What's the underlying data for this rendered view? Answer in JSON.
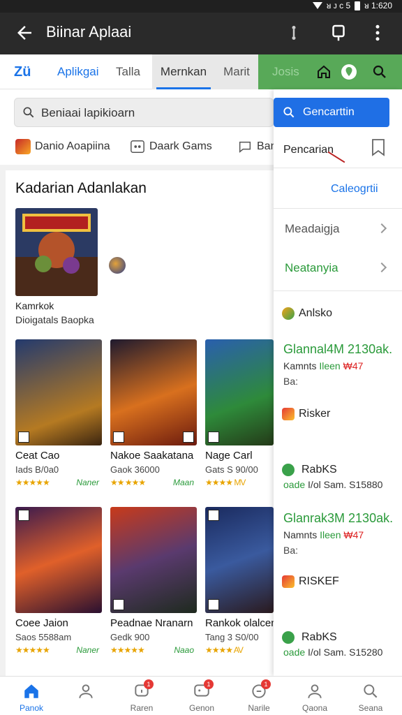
{
  "status_bar": {
    "time": "ᴚ 1:620",
    "carrier": "ᴚ ᴊ ᴄ 5"
  },
  "app_bar": {
    "title": "Biinar Aplaai",
    "back_icon": "arrow-left-icon",
    "actions": [
      "share-icon",
      "cast-icon",
      "more-vert-icon"
    ]
  },
  "tabs": [
    {
      "label": "Zü"
    },
    {
      "label": "Aplikgai"
    },
    {
      "label": "Talla"
    },
    {
      "label": "Mernkan",
      "active": true
    },
    {
      "label": "Marit"
    },
    {
      "label": "Josis"
    }
  ],
  "search": {
    "placeholder": "Beniaai lapikioarn"
  },
  "chips": [
    {
      "label": "Danio Aoapiina",
      "icon": "game-icon"
    },
    {
      "label": "Daark Gams",
      "icon": "gamepad-icon"
    },
    {
      "label": "Ban",
      "icon": "chat-icon"
    }
  ],
  "dropdown": {
    "search_button": "Gencarttin",
    "pencarian": "Pencarian",
    "category": "Caleogrtii",
    "items": [
      {
        "label": "Meadaigja",
        "color": "#555555"
      },
      {
        "label": "Neatanyia",
        "color": "#2a9a3a"
      }
    ],
    "entries": [
      {
        "type": "label",
        "text": "Anlsko"
      },
      {
        "type": "promo",
        "title": "Glannal4M 2130ak.",
        "line2_a": "Kamnts",
        "line2_b": "Ileen",
        "line2_c": "₩47",
        "line3": "Ba:"
      },
      {
        "type": "label",
        "text": "Risker"
      },
      {
        "type": "price",
        "title": "RabKS",
        "prefix": "oade",
        "line": "I/ol Sam. S15880"
      },
      {
        "type": "promo",
        "title": "Glanrak3M 2130ak.",
        "line2_a": "Namnts",
        "line2_b": "Ileen",
        "line2_c": "₩47",
        "line3": "Ba:"
      },
      {
        "type": "label",
        "text": "RISKEF"
      },
      {
        "type": "price",
        "title": "RabKS",
        "prefix": "oade",
        "line": "I/ol Sam. S15280"
      }
    ]
  },
  "main": {
    "section_title": "Kadarian Adanlakan",
    "featured": {
      "name": "Kamrkok",
      "subtitle": "Dioigatals Baopka"
    },
    "games": [
      {
        "name": "Ceat Cao",
        "meta": "Iads B/0a0",
        "stars": "★★★★★",
        "label": "Naner"
      },
      {
        "name": "Nakoe Saakatana",
        "meta": "Gaok 36000",
        "stars": "★★ ★★★",
        "label": "Maan"
      },
      {
        "name": "Nage Carl",
        "meta": "Gats  S 90/00",
        "stars": "★★★★ MV",
        "label": ""
      },
      {
        "name": "Coee Jaion",
        "meta": "Saos 5588am",
        "stars": "★★★★★",
        "label": "Naner"
      },
      {
        "name": "Peadnae Nranarn",
        "meta": "Gedk 900",
        "stars": "★★★★★",
        "label": "Naao"
      },
      {
        "name": "Rankok olalcen",
        "meta": "Tang 3 S0/00",
        "stars": "★★★★ AV",
        "label": ""
      }
    ]
  },
  "bottom_nav": [
    {
      "label": "Panok",
      "icon": "home-icon",
      "active": true
    },
    {
      "label": "",
      "icon": "person-icon"
    },
    {
      "label": "Raren",
      "icon": "bell-icon",
      "badge": "1"
    },
    {
      "label": "Genon",
      "icon": "chat-icon",
      "badge": "1"
    },
    {
      "label": "Narile",
      "icon": "refresh-icon",
      "badge": "1"
    },
    {
      "label": "Qaona",
      "icon": "person-icon"
    },
    {
      "label": "Seana",
      "icon": "search-icon"
    }
  ],
  "colors": {
    "accent": "#1a73e8",
    "green": "#58a958",
    "appbar": "#2a2a2a",
    "star": "#e8a400"
  }
}
